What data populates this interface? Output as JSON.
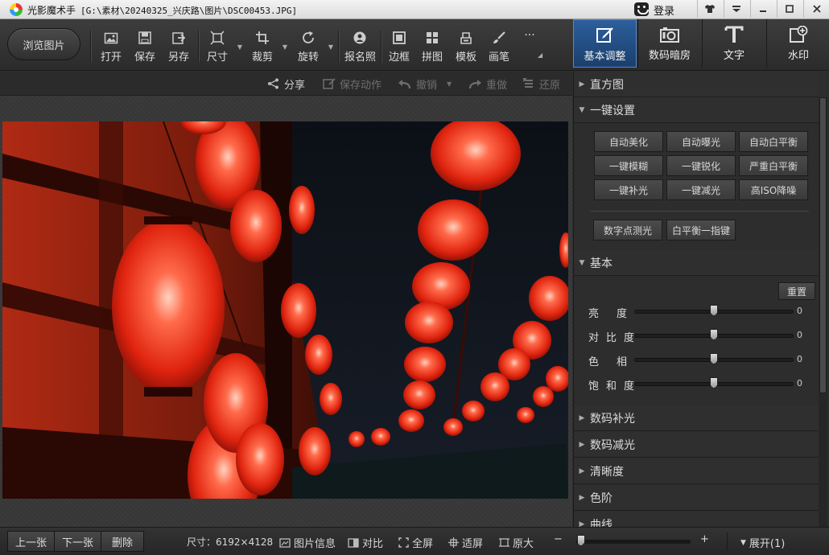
{
  "window": {
    "app_name": "光影魔术手",
    "file_path": "[G:\\素材\\20240325_兴庆路\\图片\\DSC00453.JPG]",
    "login_label": "登录",
    "controls": [
      "skin",
      "menu",
      "minimize",
      "maximize",
      "close"
    ]
  },
  "toolbar": {
    "browse_label": "浏览图片",
    "tools": [
      {
        "label": "打开",
        "icon": "open-image-icon"
      },
      {
        "label": "保存",
        "icon": "save-icon"
      },
      {
        "label": "另存",
        "icon": "save-as-icon"
      },
      {
        "label": "尺寸",
        "icon": "resize-icon",
        "dropdown": true
      },
      {
        "label": "裁剪",
        "icon": "crop-icon",
        "dropdown": true
      },
      {
        "label": "旋转",
        "icon": "rotate-icon",
        "dropdown": true
      },
      {
        "label": "报名照",
        "icon": "id-photo-icon"
      },
      {
        "label": "边框",
        "icon": "border-icon"
      },
      {
        "label": "拼图",
        "icon": "collage-icon"
      },
      {
        "label": "模板",
        "icon": "template-icon"
      },
      {
        "label": "画笔",
        "icon": "brush-icon"
      }
    ],
    "more_label": "···",
    "mode_tabs": [
      {
        "label": "基本调整",
        "icon": "adjust-icon",
        "active": true
      },
      {
        "label": "数码暗房",
        "icon": "camera-icon",
        "active": false
      },
      {
        "label": "文字",
        "icon": "text-icon",
        "active": false
      },
      {
        "label": "水印",
        "icon": "watermark-icon",
        "active": false
      }
    ]
  },
  "subbar": {
    "share": "分享",
    "save_action": "保存动作",
    "undo": "撤销",
    "redo": "重做",
    "restore": "还原"
  },
  "panel": {
    "histogram": "直方图",
    "one_click": {
      "title": "一键设置",
      "buttons": [
        "自动美化",
        "自动曝光",
        "自动白平衡",
        "一键模糊",
        "一键锐化",
        "严重白平衡",
        "一键补光",
        "一键减光",
        "高ISO降噪"
      ],
      "buttons2": [
        "数字点测光",
        "白平衡一指键"
      ]
    },
    "basic": {
      "title": "基本",
      "reset": "重置",
      "sliders": [
        {
          "label": "亮度",
          "value": "0",
          "level": 0.5
        },
        {
          "label": "对比度",
          "value": "0",
          "level": 0.5
        },
        {
          "label": "色相",
          "value": "0",
          "level": 0.5
        },
        {
          "label": "饱和度",
          "value": "0",
          "level": 0.5
        }
      ]
    },
    "sections": [
      "数码补光",
      "数码减光",
      "清晰度",
      "色阶",
      "曲线"
    ]
  },
  "status": {
    "prev": "上一张",
    "next": "下一张",
    "delete": "删除",
    "size": "尺寸：6192×4128",
    "info": "图片信息",
    "compare": "对比",
    "fullscreen": "全屏",
    "fit": "适屏",
    "original": "原大",
    "zoom_minus": "−",
    "zoom_plus": "+",
    "zoom_level": 0.04,
    "expand": "展开(1)"
  }
}
